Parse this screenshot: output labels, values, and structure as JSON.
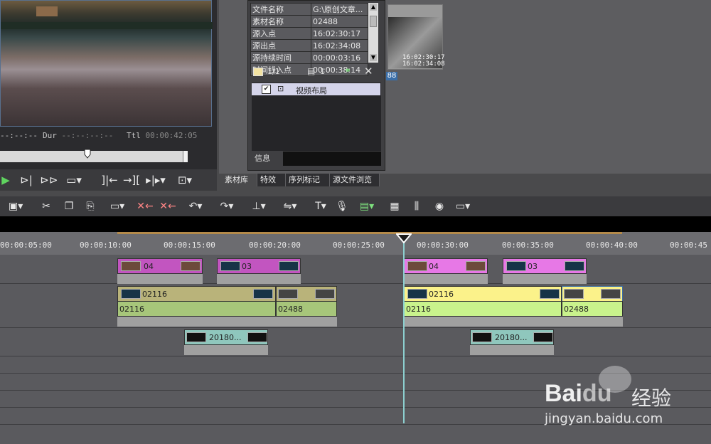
{
  "preview": {
    "dur_label": "Dur",
    "ttl_label": "Ttl",
    "ttl_value": "00:00:42:05",
    "left_timecode": "--:--:--",
    "dur_value": "--:--:--:--"
  },
  "info_panel": {
    "rows": [
      {
        "key": "文件名称",
        "value": "G:\\原创文章..."
      },
      {
        "key": "素材名称",
        "value": "02488"
      },
      {
        "key": "源入点",
        "value": "16:02:30:17"
      },
      {
        "key": "源出点",
        "value": "16:02:34:08"
      },
      {
        "key": "源持续时间",
        "value": "00:00:03:16"
      },
      {
        "key": "时间线入点",
        "value": "00:00:38:14"
      }
    ],
    "page_counter": "1/1",
    "layer_count": "1",
    "effect_item": "视频布局",
    "info_label": "信息"
  },
  "bin": {
    "clip_tc1": "16:02:30:17",
    "clip_tc2": "16:02:34:08",
    "clip_number": "88",
    "tabs": [
      "素材库",
      "特效",
      "序列标记",
      "源文件浏览"
    ]
  },
  "timeline": {
    "ruler_labels": [
      "00:00:05:00",
      "00:00:10:00",
      "00:00:15:00",
      "00:00:20:00",
      "00:00:25:00",
      "00:00:30:00",
      "00:00:35:00",
      "00:00:40:00",
      "00:00:45"
    ],
    "clips_v_pink": [
      "04",
      "03",
      "04",
      "03"
    ],
    "clips_v_main": [
      "02116",
      "02116"
    ],
    "clips_a_main": [
      "02116",
      "02488",
      "02116",
      "02488"
    ],
    "clips_bottom": [
      "20180...",
      "20180..."
    ]
  },
  "watermark": {
    "brand": "Bai",
    "brand2": "du",
    "brand_cn": "经验",
    "url": "jingyan.baidu.com"
  },
  "colors": {
    "pink_clip": "#c255c0",
    "olive_clip": "#b9b37a",
    "green_clip": "#a7c67a",
    "yellow_clip": "#fbf28a",
    "lightgreen_clip": "#c9f38c",
    "teal_clip": "#8fc7bd"
  }
}
